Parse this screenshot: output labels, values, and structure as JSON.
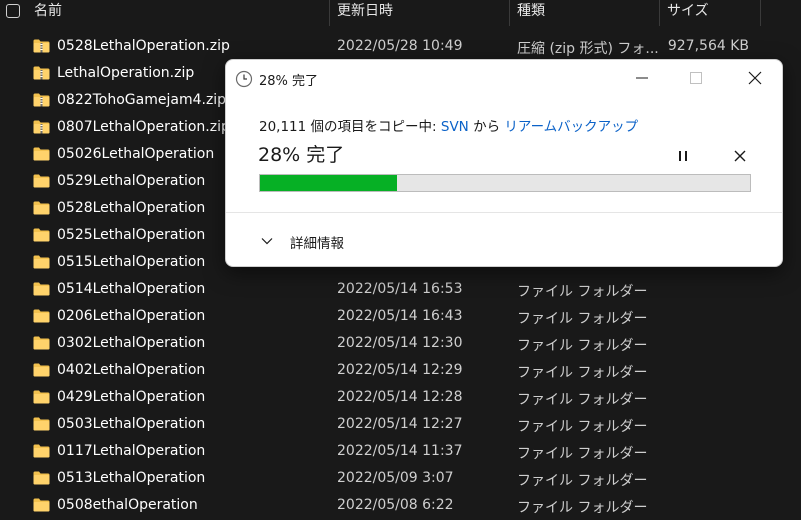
{
  "explorer": {
    "columns": {
      "name": "名前",
      "date": "更新日時",
      "type": "種類",
      "size": "サイズ"
    },
    "rows": [
      {
        "icon": "zip-folder-icon",
        "name": "0528LethalOperation.zip",
        "date": "2022/05/28 10:49",
        "type": "圧縮 (zip 形式) フォ...",
        "size": "927,564 KB"
      },
      {
        "icon": "zip-folder-icon",
        "name": "LethalOperation.zip",
        "date": "",
        "type": "",
        "size": ""
      },
      {
        "icon": "zip-folder-icon",
        "name": "0822TohoGamejam4.zip",
        "date": "",
        "type": "",
        "size": ""
      },
      {
        "icon": "zip-folder-icon",
        "name": "0807LethalOperation.zip",
        "date": "",
        "type": "",
        "size": ""
      },
      {
        "icon": "folder-icon",
        "name": "05026LethalOperation",
        "date": "",
        "type": "",
        "size": ""
      },
      {
        "icon": "folder-icon",
        "name": "0529LethalOperation",
        "date": "",
        "type": "",
        "size": ""
      },
      {
        "icon": "folder-icon",
        "name": "0528LethalOperation",
        "date": "",
        "type": "",
        "size": ""
      },
      {
        "icon": "folder-icon",
        "name": "0525LethalOperation",
        "date": "",
        "type": "",
        "size": ""
      },
      {
        "icon": "folder-icon",
        "name": "0515LethalOperation",
        "date": "",
        "type": "",
        "size": ""
      },
      {
        "icon": "folder-icon",
        "name": "0514LethalOperation",
        "date": "2022/05/14 16:53",
        "type": "ファイル フォルダー",
        "size": ""
      },
      {
        "icon": "folder-icon",
        "name": "0206LethalOperation",
        "date": "2022/05/14 16:43",
        "type": "ファイル フォルダー",
        "size": ""
      },
      {
        "icon": "folder-icon",
        "name": "0302LethalOperation",
        "date": "2022/05/14 12:30",
        "type": "ファイル フォルダー",
        "size": ""
      },
      {
        "icon": "folder-icon",
        "name": "0402LethalOperation",
        "date": "2022/05/14 12:29",
        "type": "ファイル フォルダー",
        "size": ""
      },
      {
        "icon": "folder-icon",
        "name": "0429LethalOperation",
        "date": "2022/05/14 12:28",
        "type": "ファイル フォルダー",
        "size": ""
      },
      {
        "icon": "folder-icon",
        "name": "0503LethalOperation",
        "date": "2022/05/14 12:27",
        "type": "ファイル フォルダー",
        "size": ""
      },
      {
        "icon": "folder-icon",
        "name": "0117LethalOperation",
        "date": "2022/05/14 11:37",
        "type": "ファイル フォルダー",
        "size": ""
      },
      {
        "icon": "folder-icon",
        "name": "0513LethalOperation",
        "date": "2022/05/09 3:07",
        "type": "ファイル フォルダー",
        "size": ""
      },
      {
        "icon": "folder-icon",
        "name": "0508ethalOperation",
        "date": "2022/05/08 6:22",
        "type": "ファイル フォルダー",
        "size": ""
      }
    ]
  },
  "dialog": {
    "title": "28% 完了",
    "desc_prefix": "20,111 個の項目をコピー中: ",
    "source": "SVN",
    "from": " から ",
    "destination": "リアームバックアップ",
    "percent_label": "28% 完了",
    "progress": 0.28,
    "more_details": "詳細情報"
  },
  "colors": {
    "folder": "#f2c14e",
    "progress_fill": "#06b025",
    "link": "#0b62c8",
    "background": "#191919"
  }
}
